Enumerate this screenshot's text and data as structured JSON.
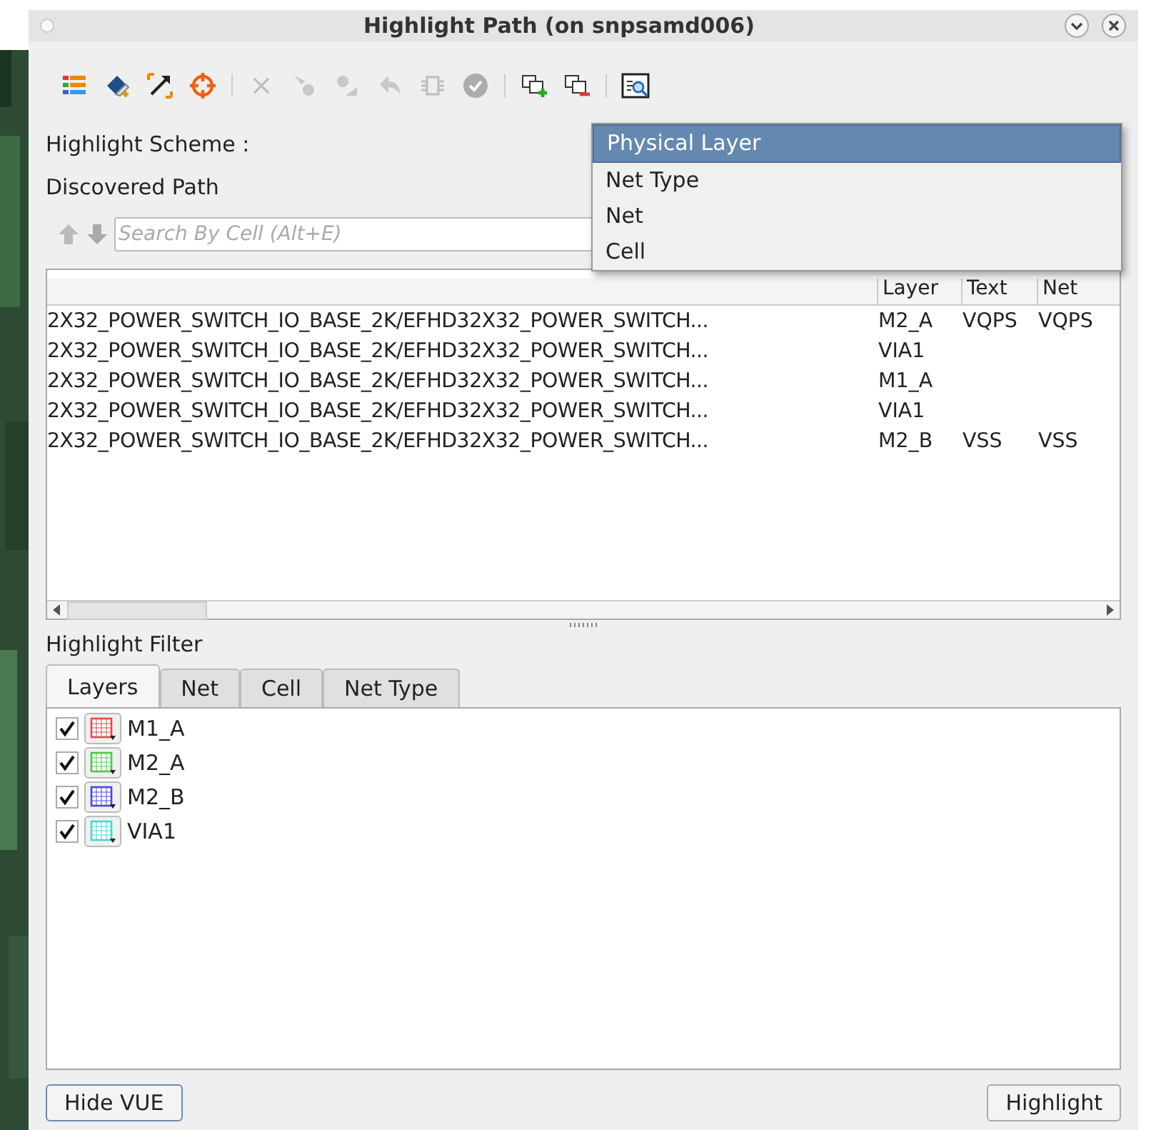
{
  "window": {
    "title": "Highlight Path (on snpsamd006)"
  },
  "toolbar": [
    {
      "kind": "list",
      "disabled": false
    },
    {
      "kind": "eraser",
      "disabled": false
    },
    {
      "kind": "expand",
      "disabled": false
    },
    {
      "kind": "target",
      "disabled": false
    },
    {
      "kind": "sep"
    },
    {
      "kind": "cross",
      "disabled": true
    },
    {
      "kind": "pointer",
      "disabled": true
    },
    {
      "kind": "pointer2",
      "disabled": true
    },
    {
      "kind": "undo",
      "disabled": true
    },
    {
      "kind": "chip",
      "disabled": true
    },
    {
      "kind": "check",
      "disabled": true
    },
    {
      "kind": "sep"
    },
    {
      "kind": "add",
      "disabled": false
    },
    {
      "kind": "remove",
      "disabled": false
    },
    {
      "kind": "sep"
    },
    {
      "kind": "zoom",
      "disabled": false
    }
  ],
  "highlight_scheme": {
    "label": "Highlight Scheme :",
    "menu": [
      {
        "label": "Physical Layer",
        "selected": true
      },
      {
        "label": "Net Type",
        "selected": false
      },
      {
        "label": "Net",
        "selected": false
      },
      {
        "label": "Cell",
        "selected": false
      }
    ]
  },
  "discovered_path": {
    "label": "Discovered Path",
    "search": {
      "placeholder": "Search By Cell (Alt+E)"
    },
    "table": {
      "columns": [
        "",
        "Layer",
        "Text",
        "Net"
      ],
      "rows": [
        [
          "2X32_POWER_SWITCH_IO_BASE_2K/EFHD32X32_POWER_SWITCH...",
          "M2_A",
          "VQPS",
          "VQPS"
        ],
        [
          "2X32_POWER_SWITCH_IO_BASE_2K/EFHD32X32_POWER_SWITCH...",
          "VIA1",
          "",
          ""
        ],
        [
          "2X32_POWER_SWITCH_IO_BASE_2K/EFHD32X32_POWER_SWITCH...",
          "M1_A",
          "",
          ""
        ],
        [
          "2X32_POWER_SWITCH_IO_BASE_2K/EFHD32X32_POWER_SWITCH...",
          "VIA1",
          "",
          ""
        ],
        [
          "2X32_POWER_SWITCH_IO_BASE_2K/EFHD32X32_POWER_SWITCH...",
          "M2_B",
          "VSS",
          "VSS"
        ]
      ]
    }
  },
  "highlight_filter": {
    "label": "Highlight Filter",
    "tabs": [
      {
        "label": "Layers",
        "selected": true
      },
      {
        "label": "Net",
        "selected": false
      },
      {
        "label": "Cell",
        "selected": false
      },
      {
        "label": "Net Type",
        "selected": false
      }
    ],
    "layers": [
      {
        "label": "M1_A",
        "checked": true,
        "color": "#e84848"
      },
      {
        "label": "M2_A",
        "checked": true,
        "color": "#44cc44"
      },
      {
        "label": "M2_B",
        "checked": true,
        "color": "#4848d8"
      },
      {
        "label": "VIA1",
        "checked": true,
        "color": "#40d8d8"
      }
    ]
  },
  "buttons": [
    {
      "label": "Hide VUE"
    },
    {
      "label": "Highlight"
    }
  ]
}
